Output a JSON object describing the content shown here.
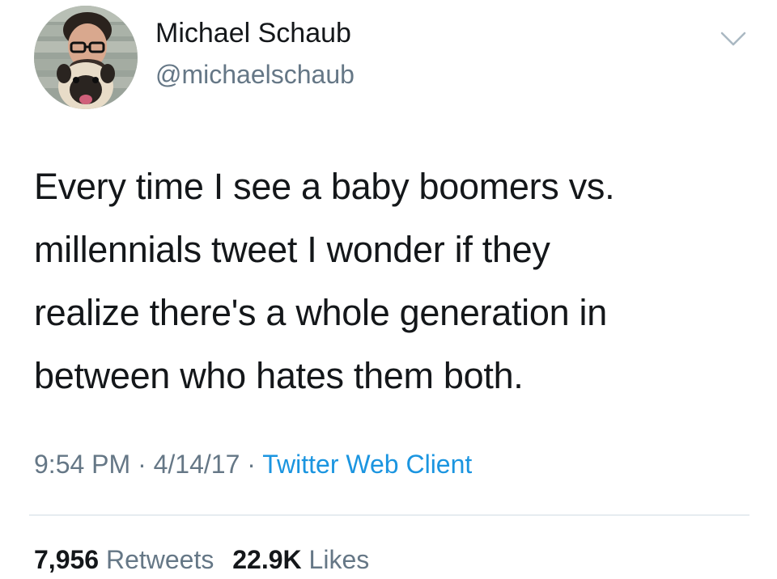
{
  "tweet": {
    "author": {
      "display_name": "Michael Schaub",
      "handle": "@michaelschaub",
      "avatar_icon": "profile-photo-avatar"
    },
    "text_lines": [
      "Every time I see a baby boomers vs.",
      "millennials tweet I wonder if they",
      "realize there's a whole generation in",
      "between who hates them both."
    ],
    "meta": {
      "time": "9:54 PM",
      "separator": "·",
      "date": "4/14/17",
      "client": "Twitter Web Client"
    },
    "stats": {
      "retweets_count": "7,956",
      "retweets_label": "Retweets",
      "likes_count": "22.9K",
      "likes_label": "Likes"
    },
    "menu_icon": "chevron-down-icon",
    "colors": {
      "text": "#14171a",
      "secondary": "#657786",
      "link": "#1b95e0",
      "divider": "#e6ecf0"
    }
  }
}
